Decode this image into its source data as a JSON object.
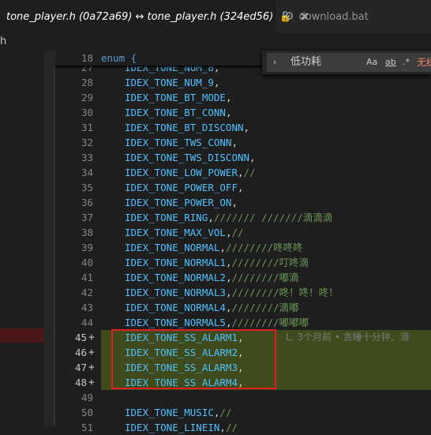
{
  "tabs": {
    "active_title": "tone_player.h (0a72a69) ↔ tone_player.h (324ed56)",
    "lock_icon": "🔓",
    "close_icon": "✕",
    "inactive_title": "download.bat",
    "gear_icon": "⚙"
  },
  "breadcrumb": {
    "text": "h"
  },
  "find": {
    "query": "低功耗",
    "match_case": "Aa",
    "whole_word": "ab",
    "regex": ".*",
    "result": "无结果"
  },
  "sticky": {
    "line_no": "18",
    "code": "enum {"
  },
  "lines": [
    {
      "no": "27",
      "code": "IDEX_TONE_NUM_8,",
      "comment": ""
    },
    {
      "no": "28",
      "code": "IDEX_TONE_NUM_9,",
      "comment": ""
    },
    {
      "no": "29",
      "code": "IDEX_TONE_BT_MODE,",
      "comment": ""
    },
    {
      "no": "30",
      "code": "IDEX_TONE_BT_CONN,",
      "comment": ""
    },
    {
      "no": "31",
      "code": "IDEX_TONE_BT_DISCONN,",
      "comment": ""
    },
    {
      "no": "32",
      "code": "IDEX_TONE_TWS_CONN,",
      "comment": ""
    },
    {
      "no": "33",
      "code": "IDEX_TONE_TWS_DISCONN,",
      "comment": ""
    },
    {
      "no": "34",
      "code": "IDEX_TONE_LOW_POWER,",
      "comment": "//"
    },
    {
      "no": "35",
      "code": "IDEX_TONE_POWER_OFF,",
      "comment": ""
    },
    {
      "no": "36",
      "code": "IDEX_TONE_POWER_ON,",
      "comment": ""
    },
    {
      "no": "37",
      "code": "IDEX_TONE_RING,",
      "comment": "/////// ///////滴滴滴"
    },
    {
      "no": "38",
      "code": "IDEX_TONE_MAX_VOL,",
      "comment": "//"
    },
    {
      "no": "39",
      "code": "IDEX_TONE_NORMAL,",
      "comment": "////////咚咚咚"
    },
    {
      "no": "40",
      "code": "IDEX_TONE_NORMAL1,",
      "comment": "////////叮咚滴"
    },
    {
      "no": "41",
      "code": "IDEX_TONE_NORMAL2,",
      "comment": "////////嘟滴"
    },
    {
      "no": "42",
      "code": "IDEX_TONE_NORMAL3,",
      "comment": "////////咚！咚！咚！"
    },
    {
      "no": "43",
      "code": "IDEX_TONE_NORMAL4,",
      "comment": "////////滴嘟"
    },
    {
      "no": "44",
      "code": "IDEX_TONE_NORMAL5,",
      "comment": "////////嘟嘟嘟"
    },
    {
      "no": "45",
      "code": "IDEX_TONE_SS_ALARM1,",
      "comment": "",
      "added": true
    },
    {
      "no": "46",
      "code": "IDEX_TONE_SS_ALARM2,",
      "comment": "",
      "added": true
    },
    {
      "no": "47",
      "code": "IDEX_TONE_SS_ALARM3,",
      "comment": "",
      "added": true
    },
    {
      "no": "48",
      "code": "IDEX_TONE_SS_ALARM4,",
      "comment": "",
      "added": true
    },
    {
      "no": "49",
      "code": "",
      "comment": ""
    },
    {
      "no": "50",
      "code": "IDEX_TONE_MUSIC,",
      "comment": "//"
    },
    {
      "no": "51",
      "code": "IDEX_TONE_LINEIN,",
      "comment": "//"
    }
  ],
  "blame": "L, 3个月前 • 贪睡十分钟、滑",
  "colors": {
    "added_bg": "#4b5a1e",
    "removed_bg": "#4b1818",
    "box": "#e02020"
  }
}
